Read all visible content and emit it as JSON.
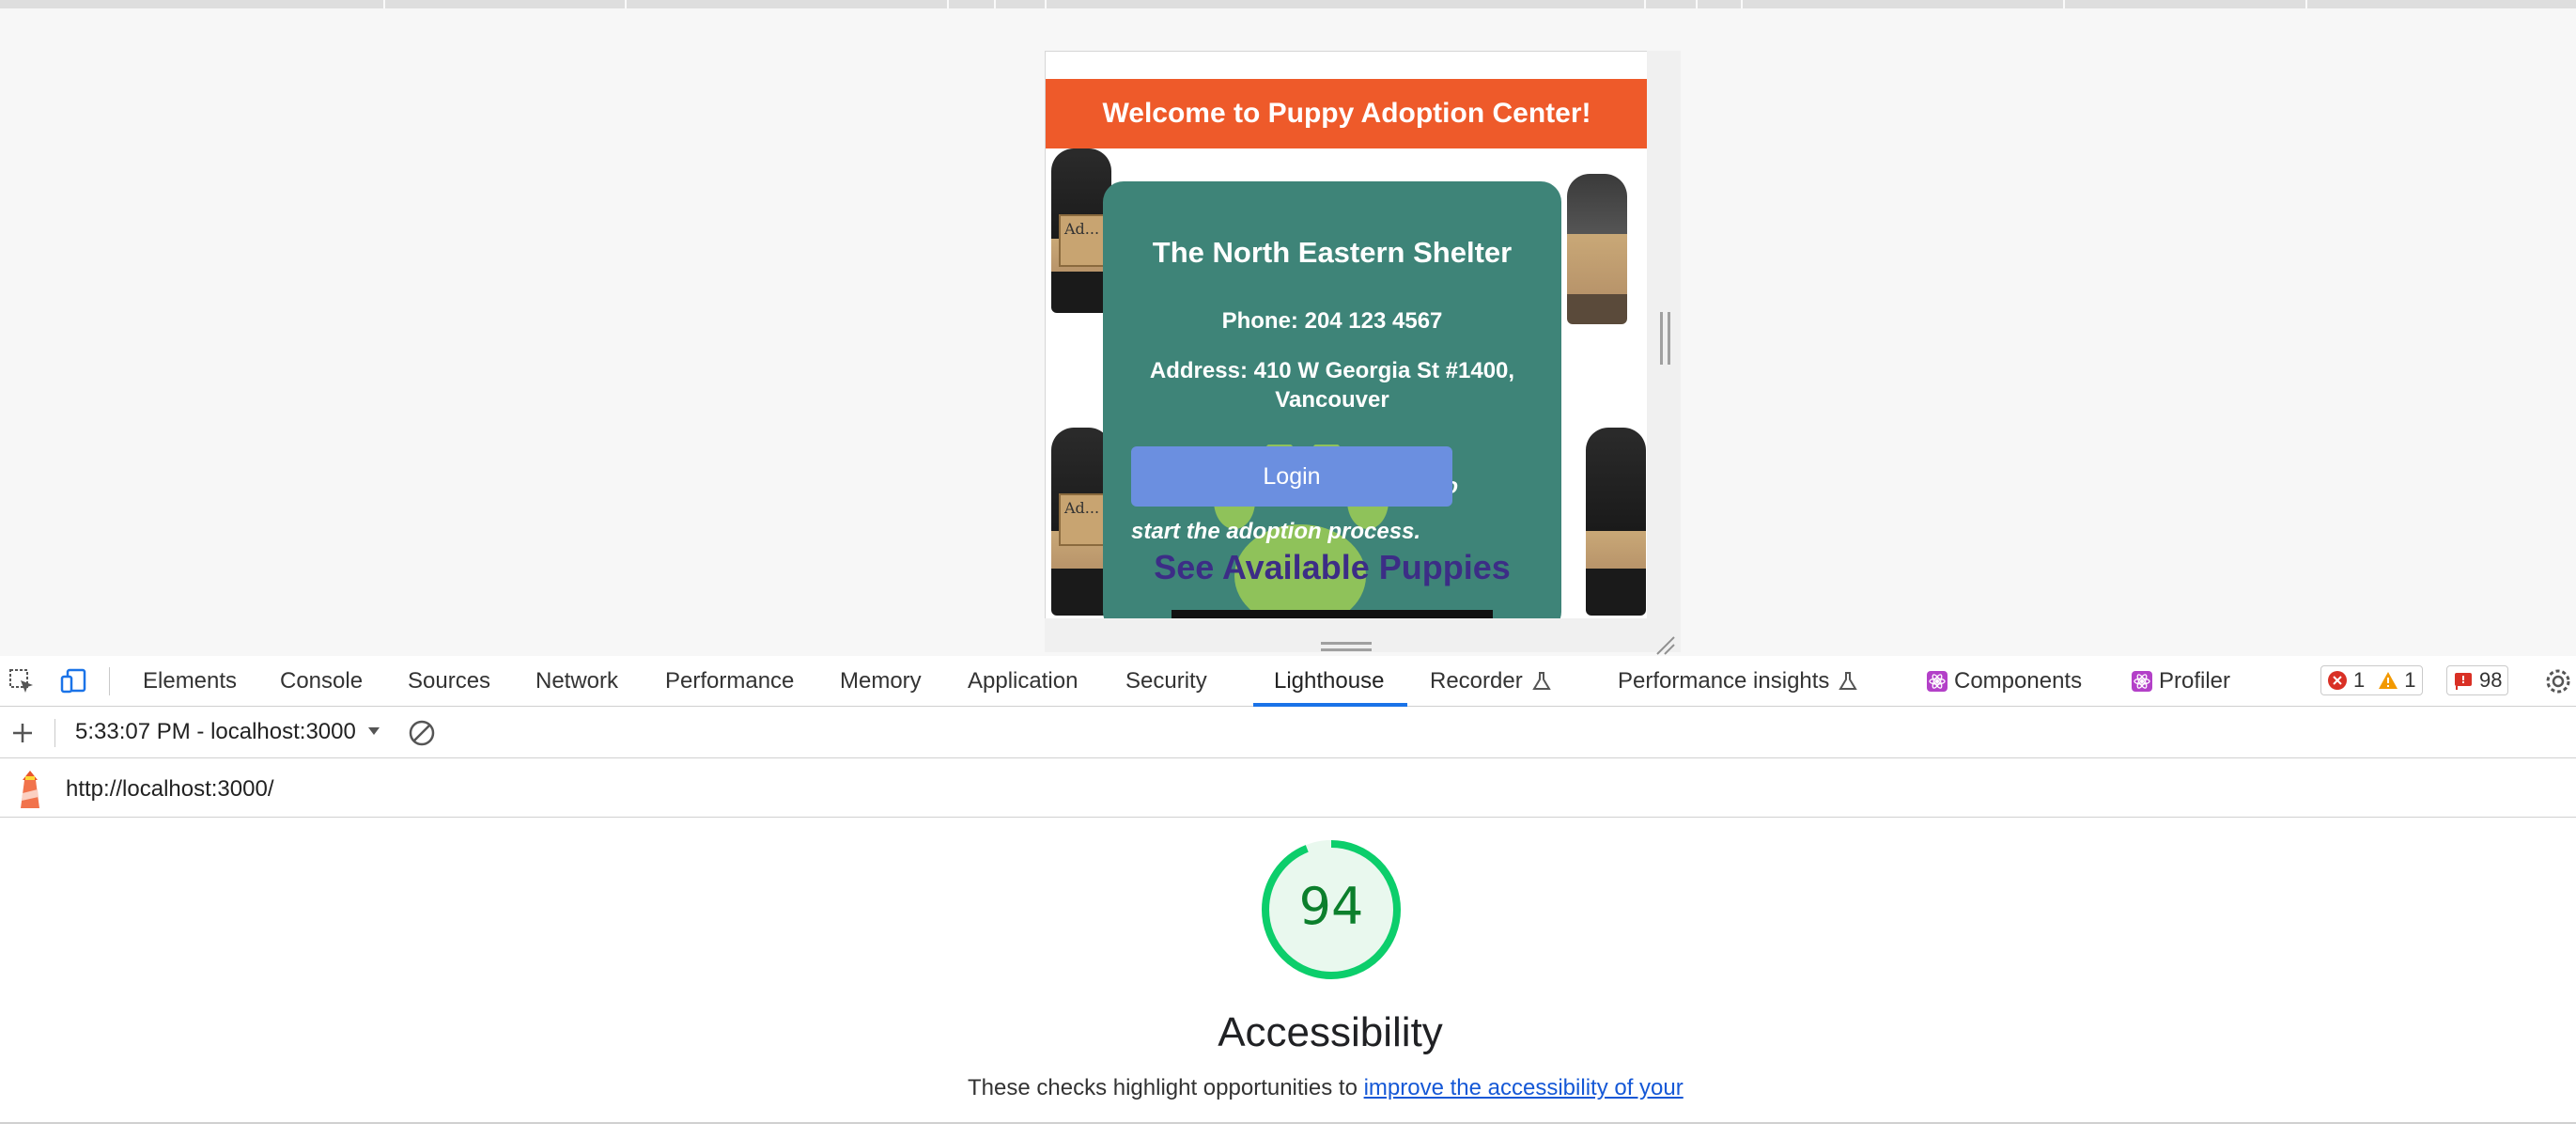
{
  "device_page": {
    "header_title": "Welcome to Puppy Adoption Center!",
    "shelter_name": "The North Eastern Shelter",
    "phone": "Phone: 204 123 4567",
    "address": "Address: 410 W Georgia St #1400, Vancouver",
    "login_label": "Login",
    "login_tail": "to",
    "italic_line2": "start the adoption process.",
    "see_puppies": "See Available Puppies",
    "dog_sign_text": "Ad..."
  },
  "devtools": {
    "tabs": [
      "Elements",
      "Console",
      "Sources",
      "Network",
      "Performance",
      "Memory",
      "Application",
      "Security",
      "Lighthouse",
      "Recorder",
      "Performance insights",
      "Components",
      "Profiler"
    ],
    "active_tab": "Lighthouse",
    "badges": {
      "errors": "1",
      "warnings": "1",
      "issues": "98"
    },
    "report_selector": "5:33:07 PM - localhost:3000",
    "url": "http://localhost:3000/",
    "score": "94",
    "category_title": "Accessibility",
    "description_prefix": "These checks highlight opportunities to ",
    "description_link": "improve the accessibility of your",
    "colors": {
      "accent": "#1a73e8",
      "score_green": "#0cce6b",
      "header_orange": "#ee5a2a",
      "card_teal": "#3e8478"
    }
  }
}
